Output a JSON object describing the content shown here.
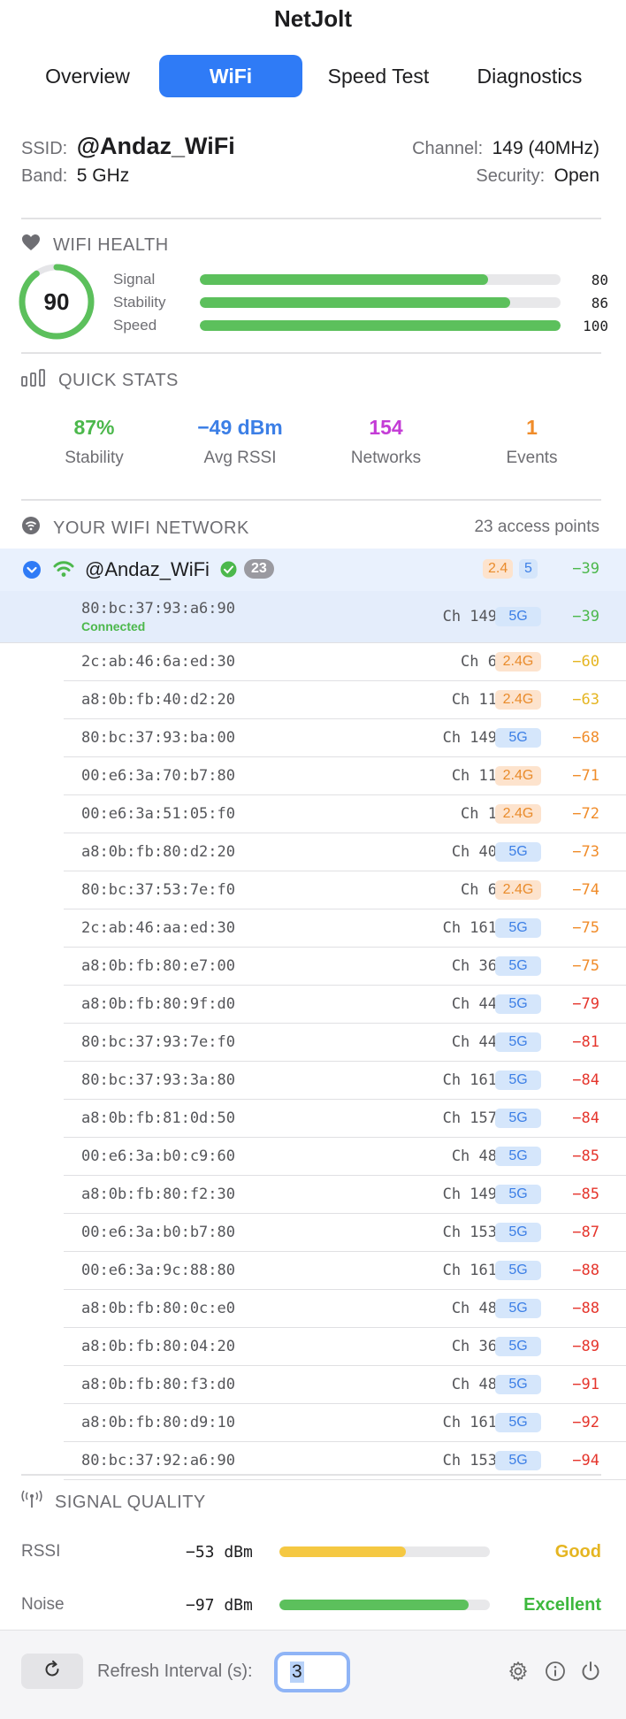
{
  "app": {
    "title": "NetJolt"
  },
  "tabs": [
    {
      "label": "Overview",
      "active": false
    },
    {
      "label": "WiFi",
      "active": true
    },
    {
      "label": "Speed Test",
      "active": false
    },
    {
      "label": "Diagnostics",
      "active": false
    }
  ],
  "info": {
    "ssid_label": "SSID:",
    "ssid": "@Andaz_WiFi",
    "band_label": "Band:",
    "band": "5 GHz",
    "channel_label": "Channel:",
    "channel": "149 (40MHz)",
    "security_label": "Security:",
    "security": "Open"
  },
  "health": {
    "title": "WIFI HEALTH",
    "score": "90",
    "score_fraction": 0.9,
    "metrics": [
      {
        "label": "Signal",
        "value": "80",
        "fraction": 0.8
      },
      {
        "label": "Stability",
        "value": "86",
        "fraction": 0.86
      },
      {
        "label": "Speed",
        "value": "100",
        "fraction": 1.0
      }
    ]
  },
  "quick_stats": {
    "title": "QUICK STATS",
    "items": [
      {
        "value": "87%",
        "label": "Stability",
        "color": "#4cb84c"
      },
      {
        "value": "−49 dBm",
        "label": "Avg RSSI",
        "color": "#3c7fe6"
      },
      {
        "value": "154",
        "label": "Networks",
        "color": "#c43cd6"
      },
      {
        "value": "1",
        "label": "Events",
        "color": "#f08c2a"
      }
    ]
  },
  "network": {
    "title": "YOUR WIFI NETWORK",
    "ap_count_text": "23 access points",
    "name": "@Andaz_WiFi",
    "count_badge": "23",
    "band24_badge": "2.4",
    "band5_badge": "5",
    "best_rssi": "−39",
    "connected_label": "Connected"
  },
  "access_points": [
    {
      "mac": "80:bc:37:93:a6:90",
      "ch": "Ch 149",
      "band": "5G",
      "rssi": "−39",
      "level": "good",
      "selected": true
    },
    {
      "mac": "2c:ab:46:6a:ed:30",
      "ch": "Ch 6",
      "band": "2.4G",
      "rssi": "−60",
      "level": "fair"
    },
    {
      "mac": "a8:0b:fb:40:d2:20",
      "ch": "Ch 11",
      "band": "2.4G",
      "rssi": "−63",
      "level": "fair"
    },
    {
      "mac": "80:bc:37:93:ba:00",
      "ch": "Ch 149",
      "band": "5G",
      "rssi": "−68",
      "level": "weak"
    },
    {
      "mac": "00:e6:3a:70:b7:80",
      "ch": "Ch 11",
      "band": "2.4G",
      "rssi": "−71",
      "level": "weak"
    },
    {
      "mac": "00:e6:3a:51:05:f0",
      "ch": "Ch 1",
      "band": "2.4G",
      "rssi": "−72",
      "level": "weak"
    },
    {
      "mac": "a8:0b:fb:80:d2:20",
      "ch": "Ch 40",
      "band": "5G",
      "rssi": "−73",
      "level": "weak"
    },
    {
      "mac": "80:bc:37:53:7e:f0",
      "ch": "Ch 6",
      "band": "2.4G",
      "rssi": "−74",
      "level": "weak"
    },
    {
      "mac": "2c:ab:46:aa:ed:30",
      "ch": "Ch 161",
      "band": "5G",
      "rssi": "−75",
      "level": "weak"
    },
    {
      "mac": "a8:0b:fb:80:e7:00",
      "ch": "Ch 36",
      "band": "5G",
      "rssi": "−75",
      "level": "weak"
    },
    {
      "mac": "a8:0b:fb:80:9f:d0",
      "ch": "Ch 44",
      "band": "5G",
      "rssi": "−79",
      "level": "poor"
    },
    {
      "mac": "80:bc:37:93:7e:f0",
      "ch": "Ch 44",
      "band": "5G",
      "rssi": "−81",
      "level": "poor"
    },
    {
      "mac": "80:bc:37:93:3a:80",
      "ch": "Ch 161",
      "band": "5G",
      "rssi": "−84",
      "level": "poor"
    },
    {
      "mac": "a8:0b:fb:81:0d:50",
      "ch": "Ch 157",
      "band": "5G",
      "rssi": "−84",
      "level": "poor"
    },
    {
      "mac": "00:e6:3a:b0:c9:60",
      "ch": "Ch 48",
      "band": "5G",
      "rssi": "−85",
      "level": "poor"
    },
    {
      "mac": "a8:0b:fb:80:f2:30",
      "ch": "Ch 149",
      "band": "5G",
      "rssi": "−85",
      "level": "poor"
    },
    {
      "mac": "00:e6:3a:b0:b7:80",
      "ch": "Ch 153",
      "band": "5G",
      "rssi": "−87",
      "level": "poor"
    },
    {
      "mac": "00:e6:3a:9c:88:80",
      "ch": "Ch 161",
      "band": "5G",
      "rssi": "−88",
      "level": "poor"
    },
    {
      "mac": "a8:0b:fb:80:0c:e0",
      "ch": "Ch 48",
      "band": "5G",
      "rssi": "−88",
      "level": "poor"
    },
    {
      "mac": "a8:0b:fb:80:04:20",
      "ch": "Ch 36",
      "band": "5G",
      "rssi": "−89",
      "level": "poor"
    },
    {
      "mac": "a8:0b:fb:80:f3:d0",
      "ch": "Ch 48",
      "band": "5G",
      "rssi": "−91",
      "level": "poor"
    },
    {
      "mac": "a8:0b:fb:80:d9:10",
      "ch": "Ch 161",
      "band": "5G",
      "rssi": "−92",
      "level": "poor"
    },
    {
      "mac": "80:bc:37:92:a6:90",
      "ch": "Ch 153",
      "band": "5G",
      "rssi": "−94",
      "level": "poor"
    }
  ],
  "signal_quality": {
    "title": "SIGNAL QUALITY",
    "rows": [
      {
        "label": "RSSI",
        "value": "−53 dBm",
        "fraction": 0.6,
        "rating": "Good",
        "color": "#f5c842",
        "rating_color": "#e5b521"
      },
      {
        "label": "Noise",
        "value": "−97 dBm",
        "fraction": 0.9,
        "rating": "Excellent",
        "color": "#5cc05c",
        "rating_color": "#3db83d"
      }
    ]
  },
  "footer": {
    "refresh_label": "Refresh Interval (s):",
    "refresh_value": "3"
  },
  "colors": {
    "accent": "#2f7bf6",
    "good": "#4cb84c",
    "fair": "#e5b521",
    "weak": "#f08c2a",
    "poor": "#e5352c"
  }
}
